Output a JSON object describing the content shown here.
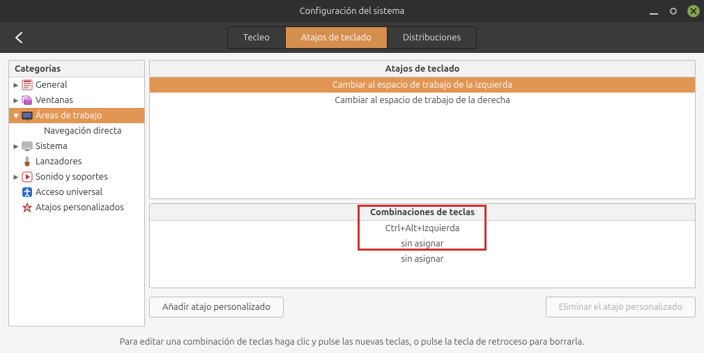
{
  "window": {
    "title": "Configuración del sistema"
  },
  "toolbar": {
    "tabs": [
      {
        "label": "Tecleo",
        "active": false
      },
      {
        "label": "Atajos de teclado",
        "active": true
      },
      {
        "label": "Distribuciones",
        "active": false
      }
    ]
  },
  "sidebar": {
    "header": "Categorías",
    "items": [
      {
        "label": "General",
        "icon": "prefs",
        "expander": "▶",
        "selected": false
      },
      {
        "label": "Ventanas",
        "icon": "windows",
        "expander": "▶",
        "selected": false
      },
      {
        "label": "Áreas de trabajo",
        "icon": "workspaces",
        "expander": "▼",
        "selected": true
      },
      {
        "label": "Navegación directa",
        "child": true
      },
      {
        "label": "Sistema",
        "icon": "system",
        "expander": "▶",
        "selected": false
      },
      {
        "label": "Lanzadores",
        "icon": "launchers",
        "expander": "",
        "selected": false
      },
      {
        "label": "Sonido y soportes",
        "icon": "media",
        "expander": "▶",
        "selected": false
      },
      {
        "label": "Acceso universal",
        "icon": "access",
        "expander": "",
        "selected": false
      },
      {
        "label": "Atajos personalizados",
        "icon": "custom",
        "expander": "",
        "selected": false
      }
    ]
  },
  "shortcuts": {
    "header": "Atajos de teclado",
    "rows": [
      {
        "label": "Cambiar al espacio de trabajo de la izquierda",
        "selected": true
      },
      {
        "label": "Cambiar al espacio de trabajo de la derecha",
        "selected": false
      }
    ]
  },
  "bindings": {
    "header": "Combinaciones de teclas",
    "rows": [
      {
        "label": "Ctrl+Alt+Izquierda"
      },
      {
        "label": "sin asignar"
      },
      {
        "label": "sin asignar"
      }
    ]
  },
  "buttons": {
    "add": "Añadir atajo personalizado",
    "remove": "Eliminar el atajo personalizado"
  },
  "footer": "Para editar una combinación de teclas haga clic y pulse las nuevas teclas, o pulse la tecla de retroceso para borrarla."
}
